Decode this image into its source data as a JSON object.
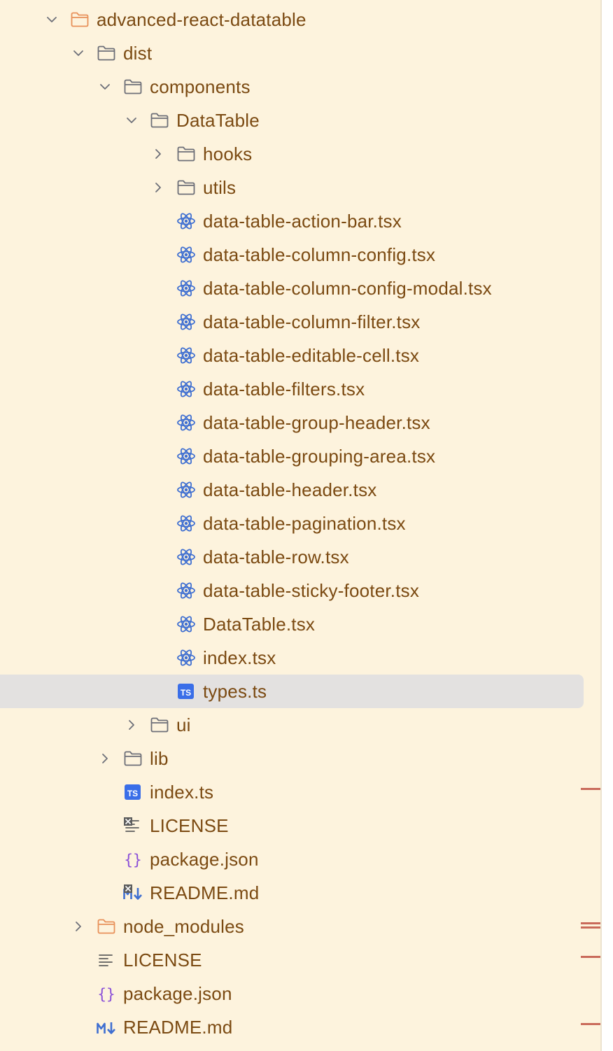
{
  "colors": {
    "background": "#fdf3dd",
    "label": "#7b4a12",
    "selected_row": "#e3e1e0",
    "folder_excluded": "#e8915a",
    "folder": "#6d6f78",
    "react_icon": "#3f6fd1",
    "ts_badge": "#3a6ee8",
    "json_icon": "#8a4fd8",
    "marker": "#c96a5a"
  },
  "tree": {
    "rows": [
      {
        "label": "advanced-react-datatable",
        "depth": 0,
        "icon": "folder-icon",
        "icon_variant": "excluded",
        "chevron": "down"
      },
      {
        "label": "dist",
        "depth": 1,
        "icon": "folder-icon",
        "chevron": "down"
      },
      {
        "label": "components",
        "depth": 2,
        "icon": "folder-icon",
        "chevron": "down"
      },
      {
        "label": "DataTable",
        "depth": 3,
        "icon": "folder-icon",
        "chevron": "down"
      },
      {
        "label": "hooks",
        "depth": 4,
        "icon": "folder-icon",
        "chevron": "right"
      },
      {
        "label": "utils",
        "depth": 4,
        "icon": "folder-icon",
        "chevron": "right"
      },
      {
        "label": "data-table-action-bar.tsx",
        "depth": 4,
        "icon": "react-icon"
      },
      {
        "label": "data-table-column-config.tsx",
        "depth": 4,
        "icon": "react-icon"
      },
      {
        "label": "data-table-column-config-modal.tsx",
        "depth": 4,
        "icon": "react-icon"
      },
      {
        "label": "data-table-column-filter.tsx",
        "depth": 4,
        "icon": "react-icon"
      },
      {
        "label": "data-table-editable-cell.tsx",
        "depth": 4,
        "icon": "react-icon"
      },
      {
        "label": "data-table-filters.tsx",
        "depth": 4,
        "icon": "react-icon"
      },
      {
        "label": "data-table-group-header.tsx",
        "depth": 4,
        "icon": "react-icon"
      },
      {
        "label": "data-table-grouping-area.tsx",
        "depth": 4,
        "icon": "react-icon"
      },
      {
        "label": "data-table-header.tsx",
        "depth": 4,
        "icon": "react-icon"
      },
      {
        "label": "data-table-pagination.tsx",
        "depth": 4,
        "icon": "react-icon"
      },
      {
        "label": "data-table-row.tsx",
        "depth": 4,
        "icon": "react-icon"
      },
      {
        "label": "data-table-sticky-footer.tsx",
        "depth": 4,
        "icon": "react-icon"
      },
      {
        "label": "DataTable.tsx",
        "depth": 4,
        "icon": "react-icon"
      },
      {
        "label": "index.tsx",
        "depth": 4,
        "icon": "react-icon"
      },
      {
        "label": "types.ts",
        "depth": 4,
        "icon": "typescript-icon",
        "badge": "TS",
        "selected": true
      },
      {
        "label": "ui",
        "depth": 3,
        "icon": "folder-icon",
        "chevron": "right"
      },
      {
        "label": "lib",
        "depth": 2,
        "icon": "folder-icon",
        "chevron": "right"
      },
      {
        "label": "index.ts",
        "depth": 2,
        "icon": "typescript-icon",
        "badge": "TS"
      },
      {
        "label": "LICENSE",
        "depth": 2,
        "icon": "text-file-icon",
        "excluded": true
      },
      {
        "label": "package.json",
        "depth": 2,
        "icon": "json-icon"
      },
      {
        "label": "README.md",
        "depth": 2,
        "icon": "markdown-icon",
        "excluded": true
      },
      {
        "label": "node_modules",
        "depth": 1,
        "icon": "folder-icon",
        "icon_variant": "excluded",
        "chevron": "right"
      },
      {
        "label": "LICENSE",
        "depth": 1,
        "icon": "text-file-icon"
      },
      {
        "label": "package.json",
        "depth": 1,
        "icon": "json-icon"
      },
      {
        "label": "README.md",
        "depth": 1,
        "icon": "markdown-icon"
      }
    ]
  },
  "scrollbar_markers": [
    {
      "row": "index.ts",
      "count": 1
    },
    {
      "row": "node_modules",
      "count": 2
    },
    {
      "row": "LICENSE",
      "count": 1
    },
    {
      "row": "README.md",
      "count": 1
    }
  ]
}
